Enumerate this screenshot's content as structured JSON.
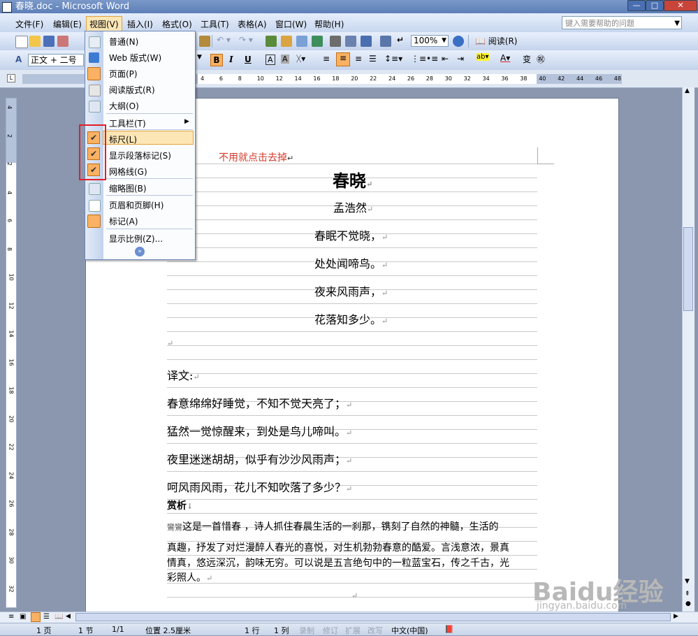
{
  "window": {
    "title": "春晓.doc - Microsoft Word"
  },
  "menubar": {
    "items": [
      "文件(F)",
      "编辑(E)",
      "视图(V)",
      "插入(I)",
      "格式(O)",
      "工具(T)",
      "表格(A)",
      "窗口(W)",
      "帮助(H)"
    ],
    "help_placeholder": "键入需要帮助的问题"
  },
  "toolbar": {
    "zoom": "100%",
    "read_label": "阅读(R)",
    "style": "正文 + 二号",
    "bold": "B",
    "italic": "I",
    "underline": "U"
  },
  "ruler": {
    "ticks": [
      "4",
      "6",
      "8",
      "10",
      "12",
      "14",
      "16",
      "18",
      "20",
      "22",
      "24",
      "26",
      "28",
      "30",
      "32",
      "34",
      "36",
      "38",
      "40",
      "42",
      "44",
      "46",
      "48"
    ]
  },
  "vruler": {
    "ticks": [
      "4",
      "2",
      "2",
      "4",
      "6",
      "8",
      "10",
      "12",
      "14",
      "16",
      "18",
      "20",
      "22",
      "24",
      "26",
      "28",
      "30",
      "32"
    ]
  },
  "view_menu": {
    "items": [
      {
        "label": "普通(N)",
        "icon": "normal-view-icon"
      },
      {
        "label": "Web 版式(W)",
        "icon": "web-layout-icon"
      },
      {
        "label": "页面(P)",
        "icon": "print-layout-icon"
      },
      {
        "label": "阅读版式(R)",
        "icon": "reading-layout-icon"
      },
      {
        "label": "大纲(O)",
        "icon": "outline-icon"
      },
      {
        "label": "工具栏(T)",
        "icon": "submenu-arrow-icon"
      },
      {
        "label": "标尺(L)",
        "icon": "check-icon"
      },
      {
        "label": "显示段落标记(S)",
        "icon": "check-icon"
      },
      {
        "label": "网格线(G)",
        "icon": "check-icon"
      },
      {
        "label": "缩略图(B)",
        "icon": "thumbnail-icon"
      },
      {
        "label": "页眉和页脚(H)",
        "icon": "header-footer-icon"
      },
      {
        "label": "标记(A)",
        "icon": "markup-icon"
      },
      {
        "label": "显示比例(Z)...",
        "icon": ""
      }
    ]
  },
  "annotation": "不用就点击去掉",
  "document": {
    "title": "春晓",
    "author": "孟浩然",
    "lines": [
      "春眠不觉晓，",
      "处处闻啼鸟。",
      "夜来风雨声，",
      "花落知多少。"
    ],
    "translation_heading": "译文:",
    "translation": [
      "春意绵绵好睡觉，不知不觉天亮了；",
      "猛然一觉惊醒来，到处是鸟儿啼叫。",
      "夜里迷迷胡胡，似乎有沙沙风雨声；",
      "呵风雨风雨，花儿不知吹落了多少？"
    ],
    "appreciation_heading": "赏析",
    "appreciation": [
      "这是一首惜春 ，诗人抓住春晨生活的一刹那，镌刻了自然的神髓，生活的",
      "真趣，抒发了对烂漫醉人春光的喜悦，对生机勃勃春意的酷爱。言浅意浓，景真",
      "情真，悠远深沉，韵味无穷。可以说是五言绝句中的一粒蓝宝石，传之千古，光",
      "彩照人。"
    ]
  },
  "statusbar": {
    "page": "1 页",
    "section": "1 节",
    "pages": "1/1",
    "position": "位置 2.5厘米",
    "line": "1 行",
    "column": "1 列",
    "rec": "录制",
    "trk": "修订",
    "ext": "扩展",
    "ovr": "改写",
    "language": "中文(中国)"
  },
  "watermark": {
    "logo": "Baidu经验",
    "url": "jingyan.baidu.com"
  }
}
